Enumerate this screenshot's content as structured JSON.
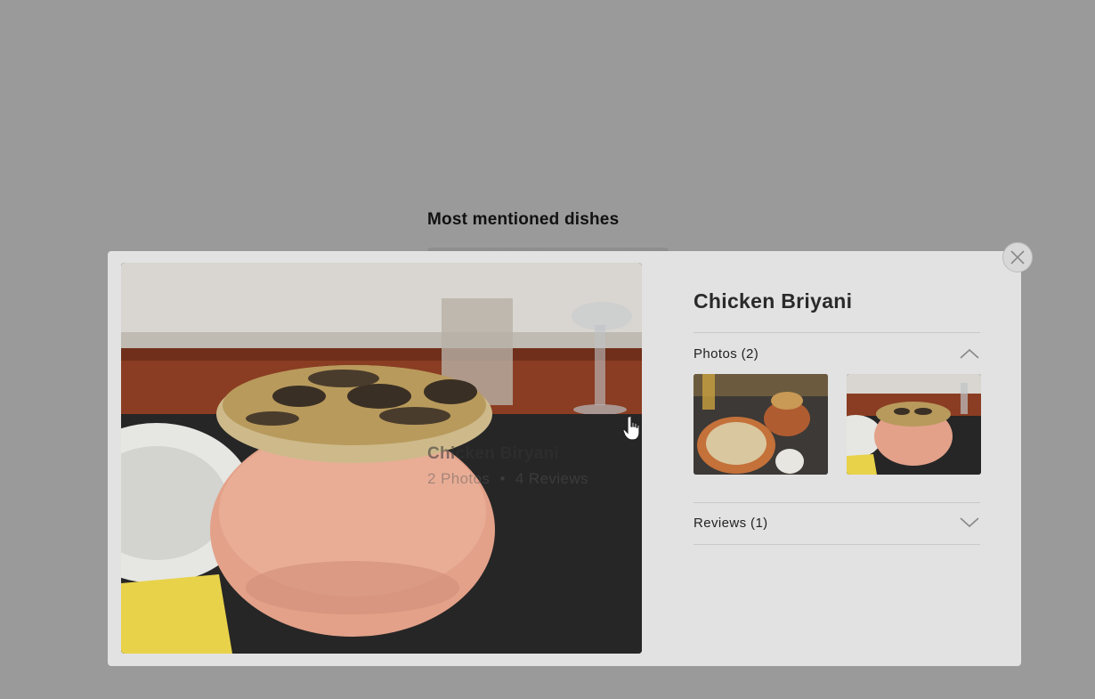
{
  "background": {
    "section_title": "Most mentioned dishes",
    "card": {
      "name": "Chicken Biryani",
      "photos": "2 Photos",
      "separator": "•",
      "reviews": "4 Reviews"
    }
  },
  "modal": {
    "dish_title": "Chicken Briyani",
    "photos_section": {
      "label": "Photos (2)",
      "expanded": true
    },
    "reviews_section": {
      "label": "Reviews (1)",
      "expanded": false
    },
    "close_icon": "close-icon"
  },
  "colors": {
    "overlay": "#9a9a9a",
    "modal_bg": "#e2e2e2",
    "title_text": "#2a2a2a"
  }
}
